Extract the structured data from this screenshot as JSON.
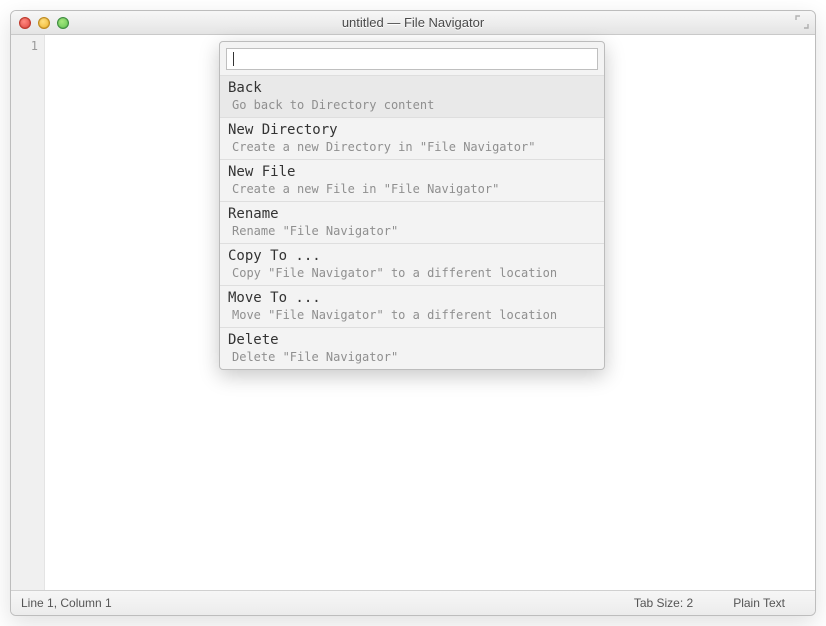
{
  "window": {
    "title": "untitled — File Navigator"
  },
  "gutter": {
    "line1": "1"
  },
  "popup": {
    "input_value": "",
    "items": [
      {
        "title": "Back",
        "desc": "Go back to Directory content",
        "selected": true
      },
      {
        "title": "New Directory",
        "desc": "Create a new Directory in \"File Navigator\"",
        "selected": false
      },
      {
        "title": "New File",
        "desc": "Create a new File in \"File Navigator\"",
        "selected": false
      },
      {
        "title": "Rename",
        "desc": "Rename \"File Navigator\"",
        "selected": false
      },
      {
        "title": "Copy To ...",
        "desc": "Copy \"File Navigator\" to a different location",
        "selected": false
      },
      {
        "title": "Move To ...",
        "desc": "Move \"File Navigator\" to a different location",
        "selected": false
      },
      {
        "title": "Delete",
        "desc": "Delete \"File Navigator\"",
        "selected": false
      }
    ]
  },
  "statusbar": {
    "position": "Line 1, Column 1",
    "tabsize": "Tab Size: 2",
    "syntax": "Plain Text"
  }
}
